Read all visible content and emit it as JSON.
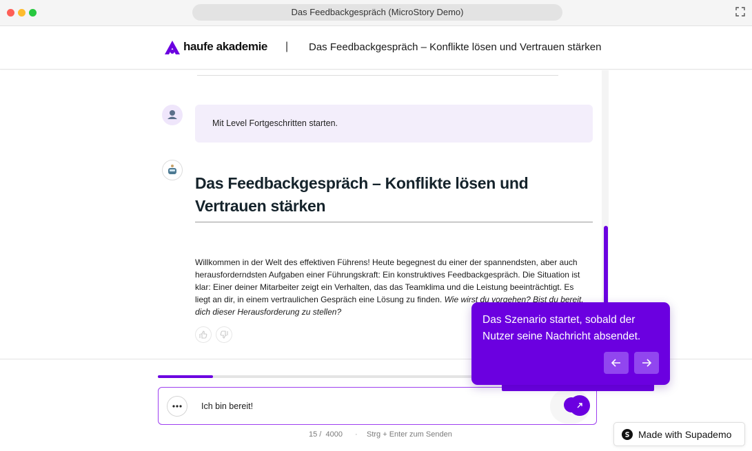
{
  "window": {
    "title": "Das Feedbackgespräch (MicroStory Demo)"
  },
  "header": {
    "logo_text": "haufe akademie",
    "separator": "|",
    "title": "Das Feedbackgespräch – Konflikte lösen und Vertrauen stärken"
  },
  "chat": {
    "user_message": "Mit Level Fortgeschritten starten.",
    "bot_title": "Das Feedbackgespräch – Konflikte lösen und Vertrauen stärken",
    "bot_body": "Willkommen in der Welt des effektiven Führens! Heute begegnest du einer der spannendsten, aber auch herausforderndsten Aufgaben einer Führungskraft: Ein konstruktives Feedbackgespräch. Die Situation ist klar: Einer deiner Mitarbeiter zeigt ein Verhalten, das das Teamklima und die Leistung beeinträchtigt. Es liegt an dir, in einem vertraulichen Gespräch eine Lösung zu finden.",
    "bot_body_italic": "Wie wirst du vorgehen? Bist du bereit, dich dieser Herausforderung zu stellen?"
  },
  "composer": {
    "progress": 0.125,
    "input_value": "Ich bin bereit!",
    "char_count": "15 /",
    "char_max": "4000",
    "separator": "·",
    "hint": "Strg + Enter zum Senden"
  },
  "tooltip": {
    "text": "Das Szenario startet, sobald der Nutzer seine Nachricht absendet."
  },
  "badge": {
    "label": "Made with Supademo"
  },
  "colors": {
    "accent": "#6b00e0",
    "accent_light": "#9146ef",
    "bubble": "#f3eefb"
  },
  "icons": [
    "haufe-logo-icon",
    "expand-icon",
    "user-avatar-icon",
    "bot-avatar-icon",
    "thumbs-up-icon",
    "thumbs-down-icon",
    "more-icon",
    "send-icon",
    "arrow-left-icon",
    "arrow-right-icon",
    "supademo-icon"
  ]
}
